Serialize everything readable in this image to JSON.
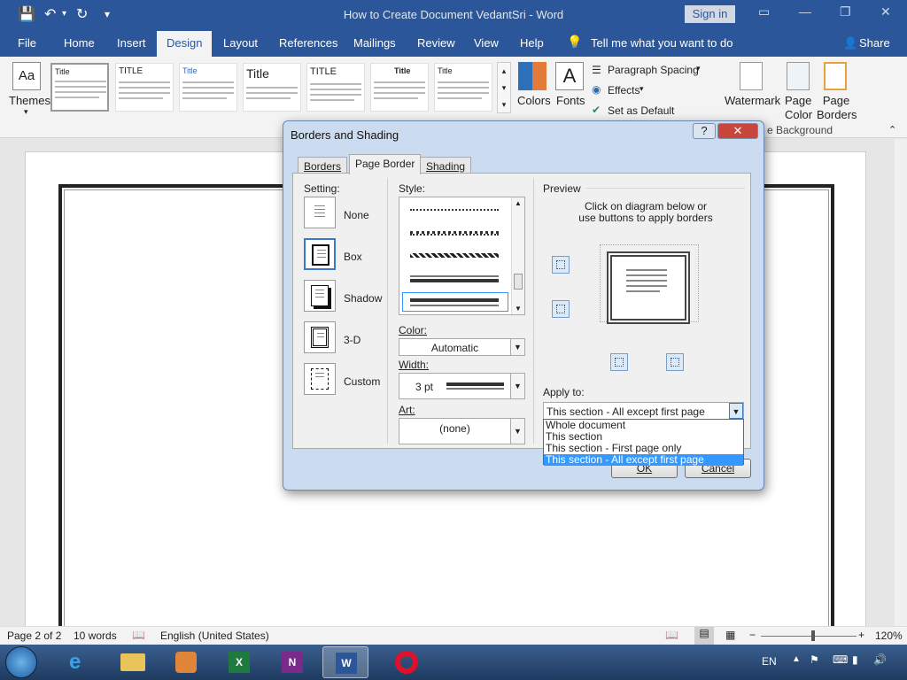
{
  "titlebar": {
    "doc_title": "How to Create Document VedantSri  -  Word",
    "signin": "Sign in"
  },
  "menu": {
    "tabs": [
      "File",
      "Home",
      "Insert",
      "Design",
      "Layout",
      "References",
      "Mailings",
      "Review",
      "View",
      "Help"
    ],
    "tell_me": "Tell me what you want to do",
    "share": "Share"
  },
  "ribbon": {
    "themes": "Themes",
    "styles": [
      "Title",
      "TITLE",
      "Title",
      "Title",
      "TITLE",
      "Title",
      "Title"
    ],
    "colors": "Colors",
    "fonts": "Fonts",
    "paragraph_spacing": "Paragraph Spacing",
    "effects": "Effects",
    "set_default": "Set as Default",
    "watermark": "Watermark",
    "page_color": "Page Color",
    "page_borders": "Page Borders",
    "group_page_background": "e Background"
  },
  "dialog": {
    "title": "Borders and Shading",
    "help": "?",
    "close": "✕",
    "tabs": [
      "Borders",
      "Page Border",
      "Shading"
    ],
    "setting_label": "Setting:",
    "settings": [
      "None",
      "Box",
      "Shadow",
      "3-D",
      "Custom"
    ],
    "style_label": "Style:",
    "color_label": "Color:",
    "color_value": "Automatic",
    "width_label": "Width:",
    "width_value": "3 pt",
    "art_label": "Art:",
    "art_value": "(none)",
    "preview_label": "Preview",
    "preview_hint_1": "Click on diagram below or",
    "preview_hint_2": "use buttons to apply borders",
    "apply_label": "Apply to:",
    "apply_value": "This section - All except first page",
    "apply_options": [
      "Whole document",
      "This section",
      "This section - First page only",
      "This section - All except first page"
    ],
    "ok": "OK",
    "cancel": "Cancel"
  },
  "status": {
    "page": "Page 2 of 2",
    "words": "10 words",
    "language": "English (United States)",
    "zoom": "120%"
  },
  "taskbar": {
    "lang": "EN"
  },
  "colors": {
    "word_blue": "#2b579a",
    "dialog_frame": "#cbdcf1",
    "selection": "#3399ff"
  }
}
